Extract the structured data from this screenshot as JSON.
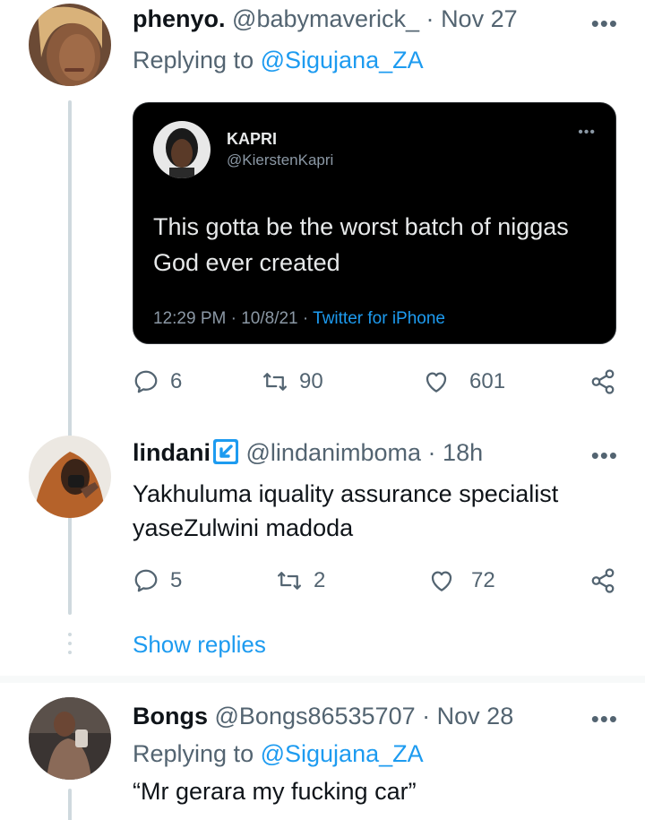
{
  "tweets": [
    {
      "name": "phenyo.",
      "handle": "@babymaverick_",
      "dot": "·",
      "date": "Nov 27",
      "more": "•••",
      "reply_prefix": "Replying to",
      "reply_mention": "@Sigujana_ZA",
      "embed": {
        "name": "KAPRI",
        "handle": "@KierstenKapri",
        "more": "•••",
        "text": "This gotta be the worst batch of niggas God ever created",
        "meta": "12:29 PM · 10/8/21 · ",
        "source": "Twitter for iPhone"
      },
      "actions": {
        "replies": "6",
        "retweets": "90",
        "likes": "601"
      }
    },
    {
      "name": "lindani",
      "handle": "@lindanimboma",
      "dot": "·",
      "date": "18h",
      "more": "•••",
      "text_line1": "Yakhuluma iquality assurance specialist",
      "text_line2": "yaseZulwini madoda",
      "actions": {
        "replies": "5",
        "retweets": "2",
        "likes": "72"
      }
    },
    {
      "name": "Bongs",
      "handle": "@Bongs86535707",
      "dot": "·",
      "date": "Nov 28",
      "more": "•••",
      "reply_prefix": "Replying to",
      "reply_mention": "@Sigujana_ZA",
      "text": "“Mr gerara my fucking car”"
    }
  ],
  "show_replies_label": "Show replies",
  "colors": {
    "accent": "#1d9bf0",
    "muted": "#536471",
    "text": "#0f1419",
    "thread_line": "#cfd9de"
  }
}
